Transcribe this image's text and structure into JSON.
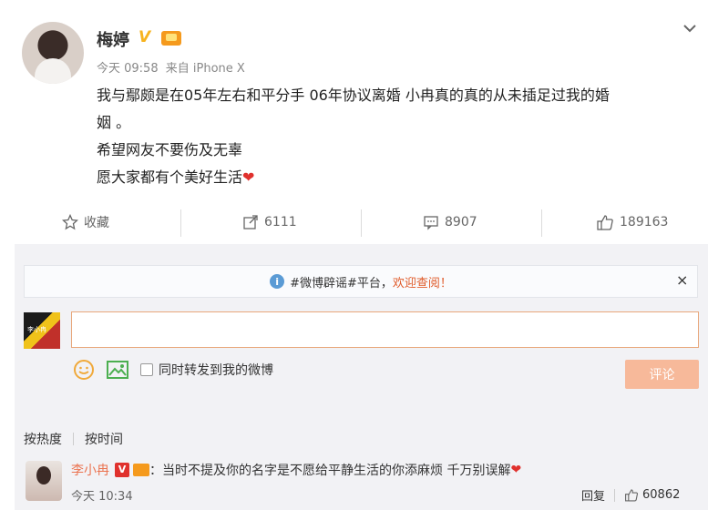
{
  "post": {
    "author": "梅婷",
    "verified_badge": "V",
    "time": "今天 09:58",
    "source": "来自 iPhone X",
    "lines": [
      "我与鄢颇是在05年左右和平分手  06年协议离婚 小冉真的真的从未插足过我的婚",
      "姻 。",
      "希望网友不要伤及无辜",
      "愿大家都有个美好生活"
    ]
  },
  "actions": {
    "favorite": "收藏",
    "repost_count": "6111",
    "comment_count": "8907",
    "like_count": "189163"
  },
  "notice": {
    "prefix": "#微博辟谣#平台，",
    "link": "欢迎查阅！",
    "close": "×"
  },
  "composer": {
    "avatar_text": "李小冉",
    "placeholder": "",
    "forward_label": "同时转发到我的微博",
    "submit_label": "评论"
  },
  "sort": {
    "hot": "按热度",
    "time": "按时间"
  },
  "reply": {
    "author": "李小冉",
    "badge": "V",
    "text": "：当时不提及你的名字是不愿给平静生活的你添麻烦 千万别误解",
    "time": "今天 10:34",
    "reply_label": "回复",
    "like_count": "60862"
  },
  "colors": {
    "accent": "#eb7350",
    "verified": "#f7b31f",
    "heart": "#e0312d"
  }
}
